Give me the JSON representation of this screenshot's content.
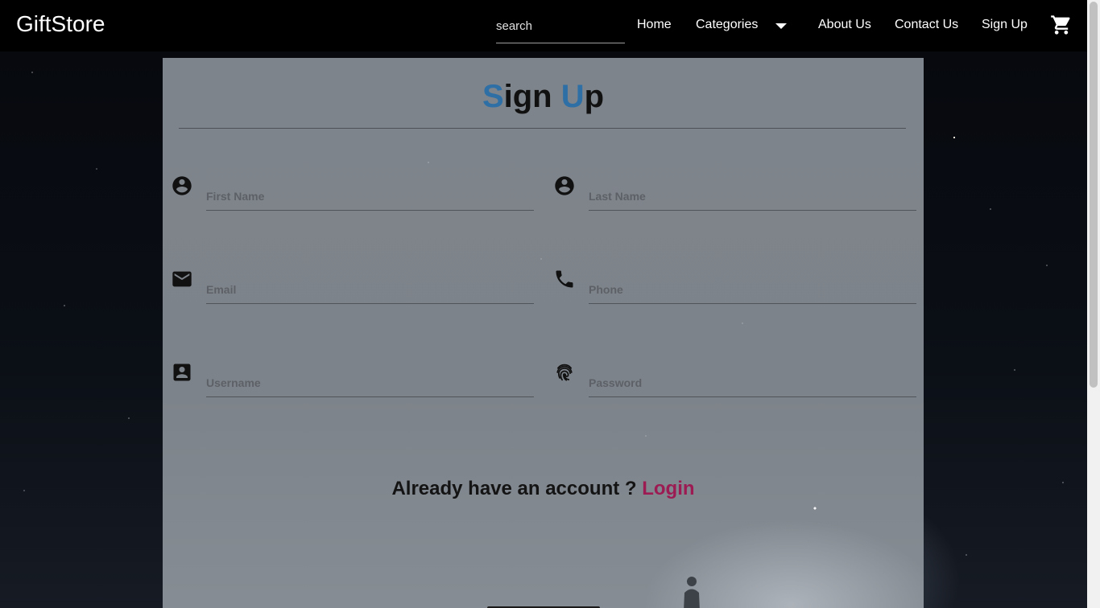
{
  "navbar": {
    "brand": "GiftStore",
    "search_placeholder": "search",
    "links": {
      "home": "Home",
      "categories": "Categories",
      "about": "About Us",
      "contact": "Contact Us",
      "signup": "Sign Up"
    },
    "icons": {
      "categories_dropdown": "caret-down-icon",
      "cart": "shopping-cart-icon"
    }
  },
  "form": {
    "title_first_initial": "S",
    "title_first_rest": "ign ",
    "title_second_initial": "U",
    "title_second_rest": "p",
    "fields": {
      "first_name": {
        "placeholder": "First Name",
        "icon": "account-circle-icon"
      },
      "last_name": {
        "placeholder": "Last Name",
        "icon": "account-circle-icon"
      },
      "email": {
        "placeholder": "Email",
        "icon": "mail-icon"
      },
      "phone": {
        "placeholder": "Phone",
        "icon": "phone-icon"
      },
      "username": {
        "placeholder": "Username",
        "icon": "account-box-icon"
      },
      "password": {
        "placeholder": "Password",
        "icon": "fingerprint-icon"
      }
    },
    "login_prompt": "Already have an account ? ",
    "login_link": "Login"
  },
  "colors": {
    "title_accent": "#2e6fa6",
    "login_link": "#9c1b52",
    "navbar_bg": "#000000"
  }
}
